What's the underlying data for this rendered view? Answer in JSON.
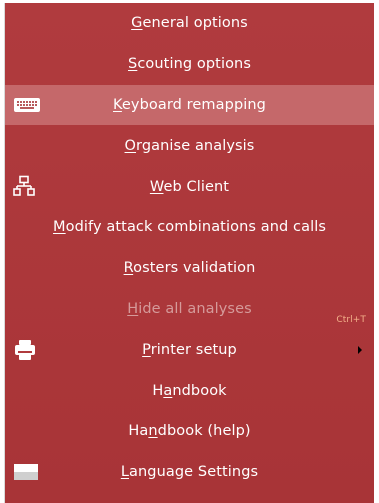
{
  "menu": {
    "items": [
      {
        "name": "general-options",
        "pre": "",
        "key": "G",
        "post": "eneral options"
      },
      {
        "name": "scouting-options",
        "pre": "",
        "key": "S",
        "post": "couting options"
      },
      {
        "name": "keyboard-remapping",
        "pre": "",
        "key": "K",
        "post": "eyboard remapping"
      },
      {
        "name": "organise-analysis",
        "pre": "",
        "key": "O",
        "post": "rganise analysis"
      },
      {
        "name": "web-client",
        "pre": "",
        "key": "W",
        "post": "eb Client"
      },
      {
        "name": "modify-attack-combinations",
        "pre": "",
        "key": "M",
        "post": "odify attack combinations and calls"
      },
      {
        "name": "rosters-validation",
        "pre": "",
        "key": "R",
        "post": "osters validation"
      },
      {
        "name": "hide-all-analyses",
        "pre": "",
        "key": "H",
        "post": "ide all analyses",
        "shortcut": "Ctrl+T"
      },
      {
        "name": "printer-setup",
        "pre": "",
        "key": "P",
        "post": "rinter setup"
      },
      {
        "name": "handbook",
        "pre": "H",
        "key": "a",
        "post": "ndbook"
      },
      {
        "name": "handbook-help",
        "pre": "Ha",
        "key": "n",
        "post": "dbook (help)"
      },
      {
        "name": "language-settings",
        "pre": "",
        "key": "L",
        "post": "anguage Settings"
      }
    ]
  },
  "icons": {
    "keyboard": "keyboard-icon",
    "web_client": "network-icon",
    "printer": "printer-icon",
    "language": "flag-icon",
    "submenu": "submenu-arrow-icon"
  },
  "colors": {
    "menu_bg": "#ad383b",
    "highlight_bg": "#c5686a",
    "text": "#ffffff",
    "disabled_text": "#d59a9a",
    "shortcut_text": "#f3b08a"
  }
}
